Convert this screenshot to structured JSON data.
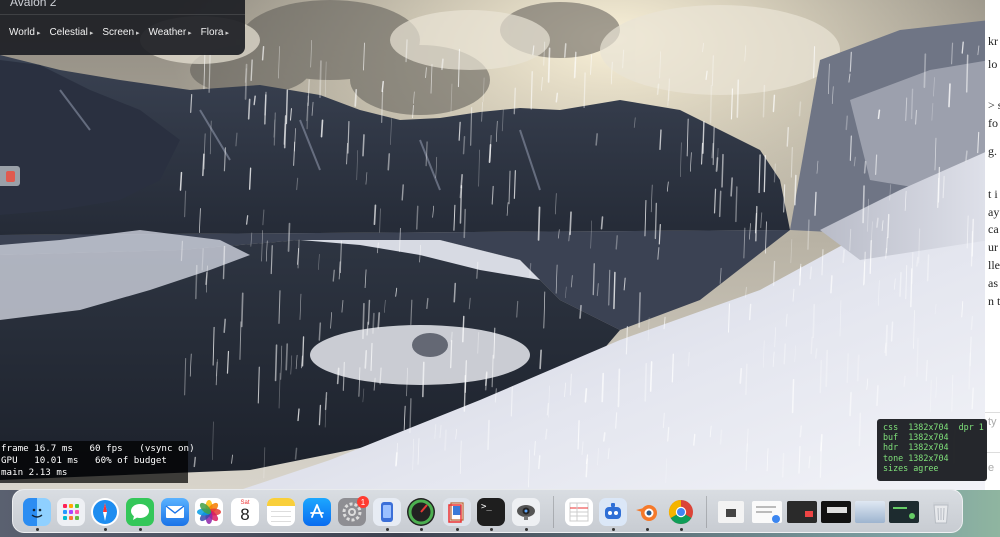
{
  "app": {
    "title": "Avalon 2",
    "menu": [
      {
        "label": "World"
      },
      {
        "label": "Celestial"
      },
      {
        "label": "Screen"
      },
      {
        "label": "Weather"
      },
      {
        "label": "Flora"
      }
    ],
    "menu_caret": "▸"
  },
  "perf_overlay": {
    "line1": "frame 16.7 ms   60 fps   (vsync on)",
    "line2": "GPU   10.01 ms   60% of budget",
    "line3": "main 2.13 ms"
  },
  "resolution_overlay": {
    "line1": "css  1382x704  dpr 1",
    "line2": "buf  1382x704",
    "line3": "hdr  1382x704",
    "line4": "tone 1382x704",
    "line5": "sizes agree"
  },
  "doc_strip": {
    "fragments": [
      "kr",
      "lo",
      "> s",
      "fo",
      "g.",
      "t i",
      "ay",
      "ca",
      "ur",
      "lle",
      "as",
      "n t"
    ],
    "footer": [
      "ty",
      "e"
    ]
  },
  "dock": {
    "items": [
      {
        "name": "finder-icon",
        "label": ""
      },
      {
        "name": "launchpad-icon",
        "label": ""
      },
      {
        "name": "safari-icon",
        "label": ""
      },
      {
        "name": "messages-icon",
        "label": ""
      },
      {
        "name": "mail-icon",
        "label": ""
      },
      {
        "name": "photos-icon",
        "label": ""
      },
      {
        "name": "calendar-icon",
        "month": "Sat",
        "day": "8"
      },
      {
        "name": "notes-icon",
        "label": ""
      },
      {
        "name": "app-store-icon",
        "label": ""
      },
      {
        "name": "system-settings-icon",
        "badge": "1"
      },
      {
        "name": "simulator-icon",
        "label": ""
      },
      {
        "name": "activity-monitor-icon",
        "label": ""
      },
      {
        "name": "preview-icon",
        "label": ""
      },
      {
        "name": "terminal-icon",
        "label": ">_"
      },
      {
        "name": "webcam-icon",
        "label": ""
      },
      {
        "name": "spreadsheet-icon",
        "label": ""
      },
      {
        "name": "bot-icon",
        "label": ""
      },
      {
        "name": "blender-icon",
        "label": ""
      },
      {
        "name": "chrome-icon",
        "label": ""
      }
    ]
  },
  "colors": {
    "perf_text": "#ffffff",
    "res_text": "#7fe07a",
    "badge": "#ff3b30"
  }
}
